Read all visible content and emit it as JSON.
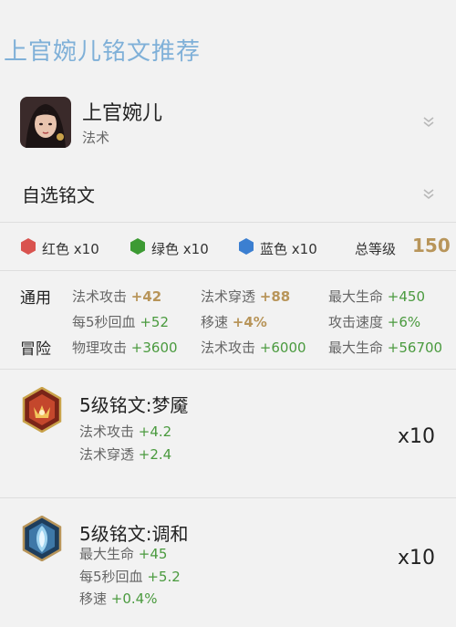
{
  "page_title": "上官婉儿铭文推荐",
  "hero": {
    "name": "上官婉儿",
    "role": "法术"
  },
  "select": {
    "label": "自选铭文"
  },
  "colors": [
    {
      "name": "红色",
      "count": "x10",
      "color": "#d9534f"
    },
    {
      "name": "绿色",
      "count": "x10",
      "color": "#3c9a33"
    },
    {
      "name": "蓝色",
      "count": "x10",
      "color": "#3b7fd1"
    }
  ],
  "total": {
    "label": "总等级",
    "value": "150"
  },
  "stats": {
    "general_label": "通用",
    "adventure_label": "冒险",
    "general": [
      {
        "name": "法术攻击",
        "value": "+42"
      },
      {
        "name": "法术穿透",
        "value": "+88"
      },
      {
        "name": "最大生命",
        "value": "+450"
      },
      {
        "name": "每5秒回血",
        "value": "+52"
      },
      {
        "name": "移速",
        "value": "+4%"
      },
      {
        "name": "攻击速度",
        "value": "+6%"
      }
    ],
    "adventure": [
      {
        "name": "物理攻击",
        "value": "+3600"
      },
      {
        "name": "法术攻击",
        "value": "+6000"
      },
      {
        "name": "最大生命",
        "value": "+56700"
      }
    ]
  },
  "inscriptions": [
    {
      "name": "5级铭文:梦魇",
      "attrs": [
        {
          "name": "法术攻击",
          "value": "+4.2"
        },
        {
          "name": "法术穿透",
          "value": "+2.4"
        }
      ],
      "count": "x10",
      "icon": "red-inscription-icon"
    },
    {
      "name": "5级铭文:调和",
      "attrs": [
        {
          "name": "最大生命",
          "value": "+45"
        },
        {
          "name": "每5秒回血",
          "value": "+5.2"
        },
        {
          "name": "移速",
          "value": "+0.4%"
        }
      ],
      "count": "x10",
      "icon": "blue-inscription-icon"
    }
  ]
}
